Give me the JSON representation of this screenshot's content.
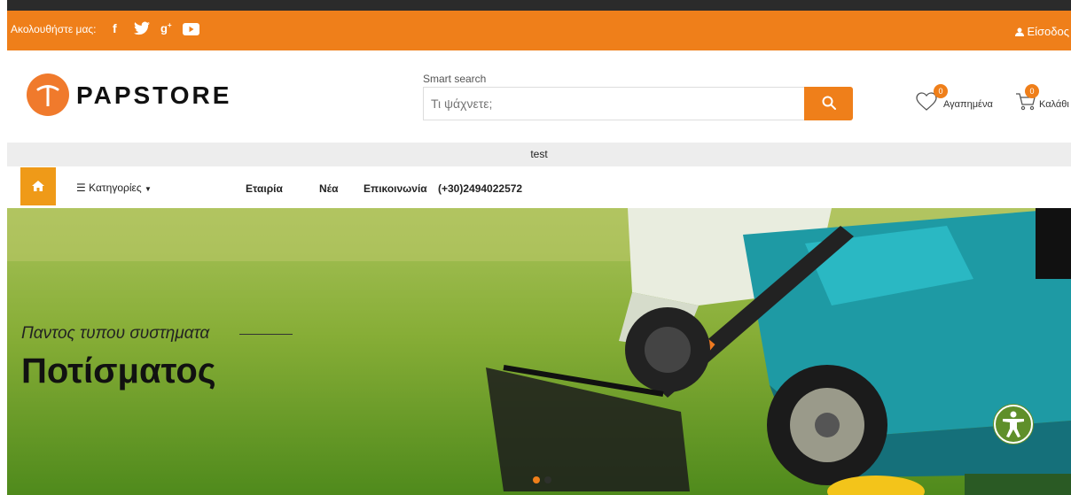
{
  "topbar": {
    "follow_label": "Ακολουθήστε μας:",
    "social": [
      "facebook-icon",
      "twitter-icon",
      "google-plus-icon",
      "youtube-icon"
    ],
    "login_label": "Είσοδος"
  },
  "header": {
    "logo_text": "PAPSTORE",
    "search": {
      "label": "Smart search",
      "placeholder": "Τι ψάχνετε;"
    },
    "wishlist": {
      "label": "Αγαπημένα",
      "count": "0"
    },
    "cart": {
      "label": "Καλάθι",
      "count": "0"
    }
  },
  "announcement": "test",
  "nav": {
    "categories_label": "Κατηγορίες",
    "links": [
      "Εταιρία",
      "Νέα",
      "Επικοινωνία",
      "(+30)2494022572"
    ]
  },
  "hero": {
    "subtitle": "Παντος τυπου συστηματα",
    "title": "Ποτίσματος"
  },
  "colors": {
    "accent": "#ef7f1a",
    "dark": "#2b2b2b",
    "gray": "#ededed"
  }
}
